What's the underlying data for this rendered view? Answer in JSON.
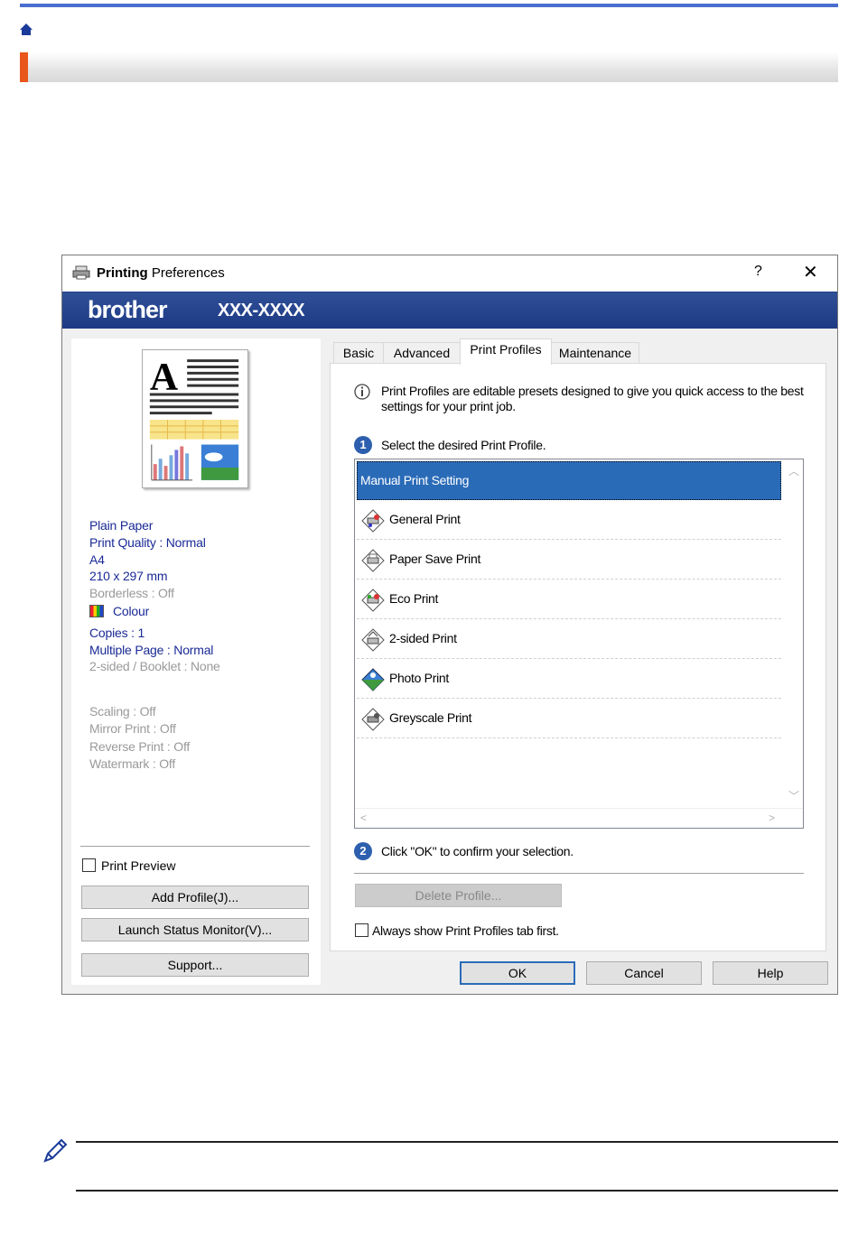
{
  "app": {
    "title_bold": "Printing",
    "title_rest": " Preferences",
    "help_glyph": "?",
    "close_glyph": "✕",
    "brand": "brother",
    "model": "XXX-XXXX"
  },
  "summary": {
    "media": "Plain Paper",
    "quality": "Print Quality : Normal",
    "paper": "A4",
    "dims": "210 x 297 mm",
    "borderless": "Borderless : Off",
    "colour": "Colour",
    "copies": "Copies : 1",
    "multiple_page": "Multiple Page : Normal",
    "sided": "2-sided / Booklet : None",
    "scaling": "Scaling : Off",
    "mirror": "Mirror Print : Off",
    "reverse": "Reverse Print : Off",
    "watermark": "Watermark : Off"
  },
  "left_controls": {
    "print_preview": "Print Preview",
    "add_profile": "Add Profile(J)...",
    "launch_status_monitor": "Launch Status Monitor(V)...",
    "support": "Support..."
  },
  "tabs": [
    {
      "label": "Basic"
    },
    {
      "label": "Advanced"
    },
    {
      "label": "Print Profiles"
    },
    {
      "label": "Maintenance"
    }
  ],
  "profiles_tab": {
    "info": "Print Profiles are editable presets designed to give you quick access to the best settings for your print job.",
    "step1_num": "1",
    "step1": "Select the desired Print Profile.",
    "items": [
      {
        "label": "Manual Print Setting",
        "selected": true
      },
      {
        "label": "General Print",
        "icon": "general-print-icon"
      },
      {
        "label": "Paper Save Print",
        "icon": "paper-save-icon"
      },
      {
        "label": "Eco Print",
        "icon": "eco-print-icon"
      },
      {
        "label": "2-sided Print",
        "icon": "two-sided-icon"
      },
      {
        "label": "Photo Print",
        "icon": "photo-print-icon"
      },
      {
        "label": "Greyscale Print",
        "icon": "greyscale-icon"
      }
    ],
    "step2_num": "2",
    "step2": "Click \"OK\" to confirm your selection.",
    "delete_profile": "Delete Profile...",
    "always_show": "Always show Print Profiles tab first."
  },
  "footer_buttons": {
    "ok": "OK",
    "cancel": "Cancel",
    "help": "Help"
  },
  "colors": {
    "accent": "#e8561a",
    "banner": "#1d3a85",
    "selection": "#2a6bb8",
    "summary_blue": "#1a2a96"
  }
}
